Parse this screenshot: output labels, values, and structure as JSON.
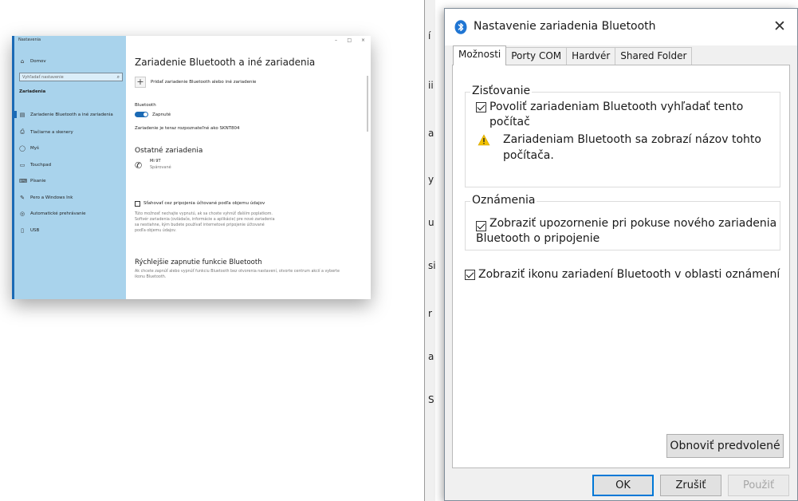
{
  "settings": {
    "window_label": "Nastavenia",
    "controls": [
      "–",
      "□",
      "×"
    ],
    "nav_home": "Domov",
    "search_placeholder": "Vyhľadať nastavenie",
    "section_heading": "Zariadenia",
    "nav_items": [
      {
        "icon": "bluetooth-devices-icon",
        "label": "Zariadenie Bluetooth a iné zariadenia"
      },
      {
        "icon": "printer-icon",
        "label": "Tlačiarne a skenery"
      },
      {
        "icon": "mouse-icon",
        "label": "Myš"
      },
      {
        "icon": "touchpad-icon",
        "label": "Touchpad"
      },
      {
        "icon": "keyboard-icon",
        "label": "Písanie"
      },
      {
        "icon": "pen-icon",
        "label": "Pero a Windows Ink"
      },
      {
        "icon": "autoplay-icon",
        "label": "Automatické prehrávanie"
      },
      {
        "icon": "usb-icon",
        "label": "USB"
      }
    ],
    "page_title": "Zariadenie Bluetooth a iné zariadenia",
    "add_device": "Pridať zariadenie Bluetooth alebo iné zariadenie",
    "bluetooth_label": "Bluetooth",
    "toggle_state": "Zapnuté",
    "discoverable_text": "Zariadenie je teraz rozpoznateľné ako SKNT804",
    "other_devices_heading": "Ostatné zariadenia",
    "device_name": "Mi 9T",
    "device_status": "Spárované",
    "metered_checkbox": "Sťahovať cez pripojenia účtované podľa objemu údajov",
    "metered_desc": [
      "Túto možnosť nechajte vypnutú, ak sa chcete vyhnúť ďalším poplatkom.",
      "Softvér zariadenia (ovládače, informácie a aplikácie) pre nové zariadenia",
      "sa nestiahne, kým budete používať internetové pripojenie účtované",
      "podľa objemu údajov."
    ],
    "faster_heading": "Rýchlejšie zapnutie funkcie Bluetooth",
    "faster_desc": [
      "Ak chcete zapnúť alebo vypnúť funkciu Bluetooth bez otvorenia nastavení, otvorte centrum akcií a vyberte",
      "ikonu Bluetooth."
    ]
  },
  "background_letters": [
    "í",
    "ii",
    "a",
    "y",
    "u",
    "si",
    "r",
    "a",
    "S"
  ],
  "dialog": {
    "title": "Nastavenie zariadenia Bluetooth",
    "close_glyph": "✕",
    "tabs": [
      "Možnosti",
      "Porty COM",
      "Hardvér",
      "Shared Folder"
    ],
    "discovery_group": "Zisťovanie",
    "allow_discovery": "Povoliť zariadeniam Bluetooth vyhľadať tento počítač",
    "allow_discovery_checked": true,
    "warning_line1": "Zariadeniam Bluetooth sa zobrazí názov tohto",
    "warning_line2": "počítača.",
    "notify_group": "Oznámenia",
    "notify_line1": "Zobraziť upozornenie pri pokuse nového zariadenia",
    "notify_line2": "Bluetooth o pripojenie",
    "notify_checked": true,
    "tray_icon": "Zobraziť ikonu zariadení Bluetooth v oblasti oznámení",
    "tray_checked": true,
    "restore_defaults": "Obnoviť predvolené",
    "ok": "OK",
    "cancel": "Zrušiť",
    "apply": "Použiť"
  },
  "colors": {
    "settings_sidebar": "#a9d3ec",
    "accent": "#1b6ab5",
    "focus_border": "#0078d7",
    "warning": "#f2c200"
  }
}
